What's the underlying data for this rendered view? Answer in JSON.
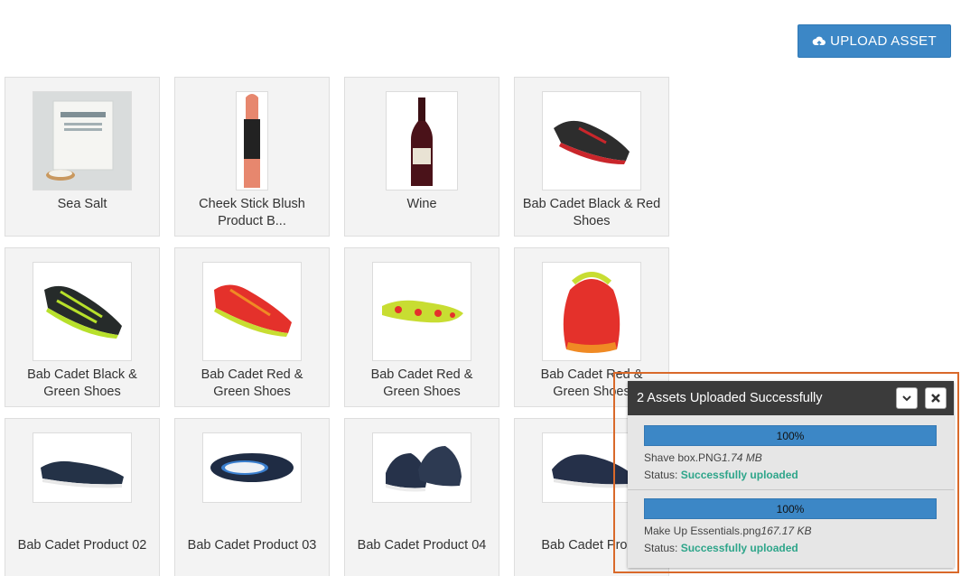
{
  "toolbar": {
    "upload_label": "UPLOAD ASSET"
  },
  "assets": [
    {
      "name": "Sea Salt"
    },
    {
      "name": "Cheek Stick Blush Product B..."
    },
    {
      "name": "Wine"
    },
    {
      "name": "Bab Cadet Black & Red Shoes"
    },
    {
      "name": "Bab Cadet Black & Green Shoes"
    },
    {
      "name": "Bab Cadet Red & Green Shoes"
    },
    {
      "name": "Bab Cadet Red & Green Shoes"
    },
    {
      "name": "Bab Cadet Red & Green Shoes"
    },
    {
      "name": "Bab Cadet Product 02"
    },
    {
      "name": "Bab Cadet Product 03"
    },
    {
      "name": "Bab Cadet Product 04"
    },
    {
      "name": "Bab Cadet Produ"
    }
  ],
  "upload_panel": {
    "title": "2 Assets Uploaded Successfully",
    "items": [
      {
        "progress": "100%",
        "filename": "Shave box.PNG",
        "size": "1.74 MB",
        "status_label": "Status:",
        "status": "Successfully uploaded"
      },
      {
        "progress": "100%",
        "filename": "Make Up Essentials.png",
        "size": "167.17 KB",
        "status_label": "Status:",
        "status": "Successfully uploaded"
      }
    ]
  },
  "colors": {
    "accent": "#3c87c6",
    "success": "#2ea58a",
    "panel_header": "#3b3b3b",
    "highlight": "#d9692a"
  }
}
